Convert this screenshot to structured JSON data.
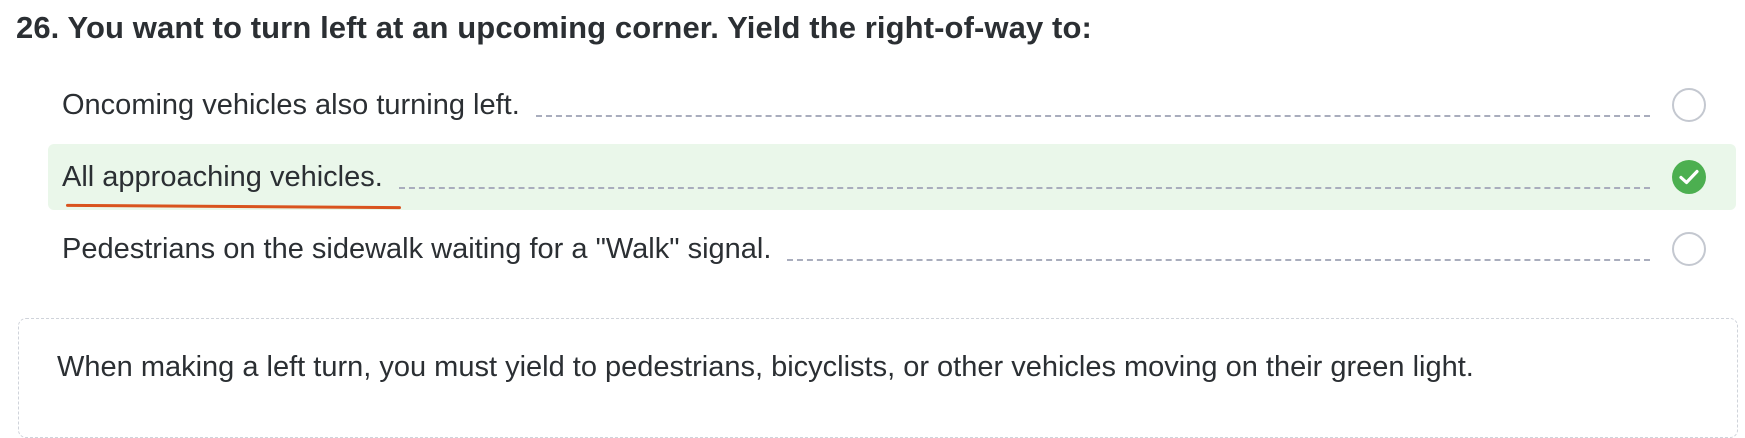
{
  "question": {
    "title": "26. You want to turn left at an upcoming corner. Yield the right-of-way to:"
  },
  "options": [
    {
      "label": "Oncoming vehicles also turning left.",
      "state": "unselected"
    },
    {
      "label": "All approaching vehicles.",
      "state": "correct"
    },
    {
      "label": "Pedestrians on the sidewalk waiting for a \"Walk\" signal.",
      "state": "unselected"
    }
  ],
  "explanation": {
    "text": "When making a left turn, you must yield to pedestrians, bicyclists, or other vehicles moving on their green light."
  },
  "colors": {
    "correct_background": "#eaf7ea",
    "check_green": "#4caf50",
    "underline_orange": "#d9531e",
    "leader_dash": "#a9adbd",
    "text": "#2b2f33"
  },
  "icons": {
    "radio_unchecked": "radio-empty-icon",
    "radio_checked": "check-circle-icon"
  }
}
